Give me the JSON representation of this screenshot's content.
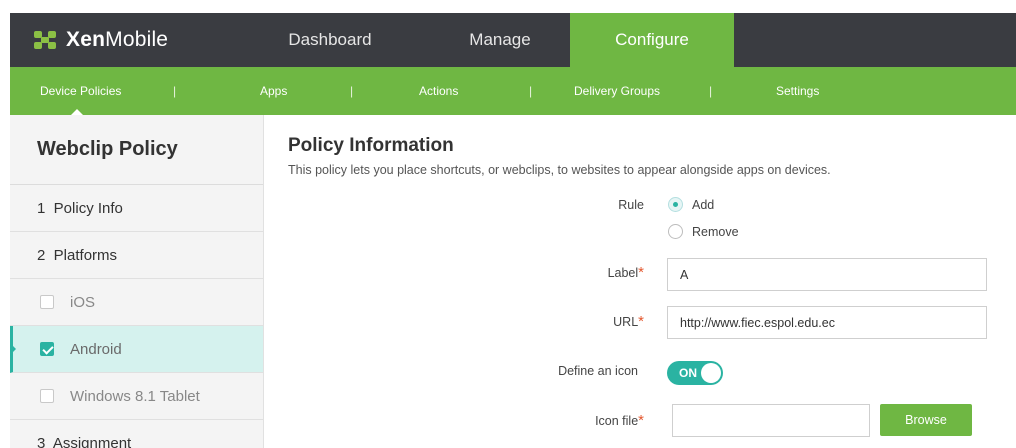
{
  "brand": {
    "name_bold": "Xen",
    "name_light": "Mobile"
  },
  "nav": {
    "tabs": [
      {
        "label": "Dashboard"
      },
      {
        "label": "Manage"
      },
      {
        "label": "Configure",
        "active": true
      }
    ]
  },
  "subnav": {
    "items": [
      {
        "label": "Device Policies",
        "active": true
      },
      {
        "label": "Apps"
      },
      {
        "label": "Actions"
      },
      {
        "label": "Delivery Groups"
      },
      {
        "label": "Settings"
      }
    ],
    "separator": "|"
  },
  "sidebar": {
    "title": "Webclip Policy",
    "steps": [
      {
        "label": "1  Policy Info"
      },
      {
        "label": "2  Platforms"
      }
    ],
    "platforms": [
      {
        "label": "iOS",
        "checked": false
      },
      {
        "label": "Android",
        "checked": true,
        "active": true
      },
      {
        "label": "Windows 8.1 Tablet",
        "checked": false
      }
    ],
    "step3": "3  Assignment"
  },
  "main": {
    "title": "Policy Information",
    "description": "This policy lets you place shortcuts, or webclips, to websites to appear alongside apps on devices.",
    "rule": {
      "label": "Rule",
      "options": [
        {
          "label": "Add",
          "selected": true
        },
        {
          "label": "Remove",
          "selected": false
        }
      ]
    },
    "label_field": {
      "label": "Label",
      "required_mark": "*",
      "value": "A"
    },
    "url_field": {
      "label": "URL",
      "required_mark": "*",
      "value": "http://www.fiec.espol.edu.ec"
    },
    "define_icon": {
      "label": "Define an icon",
      "toggle_text": "ON",
      "on": true
    },
    "icon_file": {
      "label": "Icon file",
      "required_mark": "*",
      "value": "",
      "browse_label": "Browse"
    }
  },
  "colors": {
    "topbar": "#3a3c41",
    "accent_green": "#6fb743",
    "accent_teal": "#2ab3a2",
    "active_row": "#d5f2ee",
    "required": "#e4572e"
  }
}
